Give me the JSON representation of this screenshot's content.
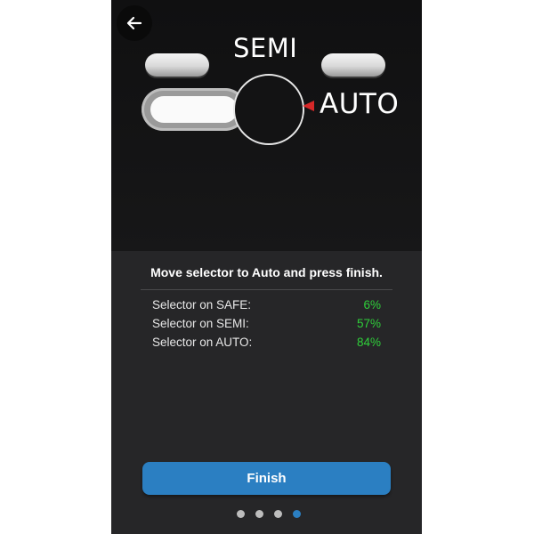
{
  "header": {
    "back_icon": "arrow-left-icon"
  },
  "selector": {
    "labels": {
      "semi": "SEMI",
      "auto": "AUTO"
    },
    "pointer_color": "#d62828"
  },
  "instruction": "Move selector to Auto and press finish.",
  "stats": [
    {
      "label": "Selector on SAFE:",
      "value": "6%"
    },
    {
      "label": "Selector on SEMI:",
      "value": "57%"
    },
    {
      "label": "Selector on AUTO:",
      "value": "84%"
    }
  ],
  "finish_label": "Finish",
  "pagination": {
    "total": 4,
    "active_index": 3
  },
  "colors": {
    "accent": "#2b7fc2",
    "success": "#2fcf3a"
  }
}
